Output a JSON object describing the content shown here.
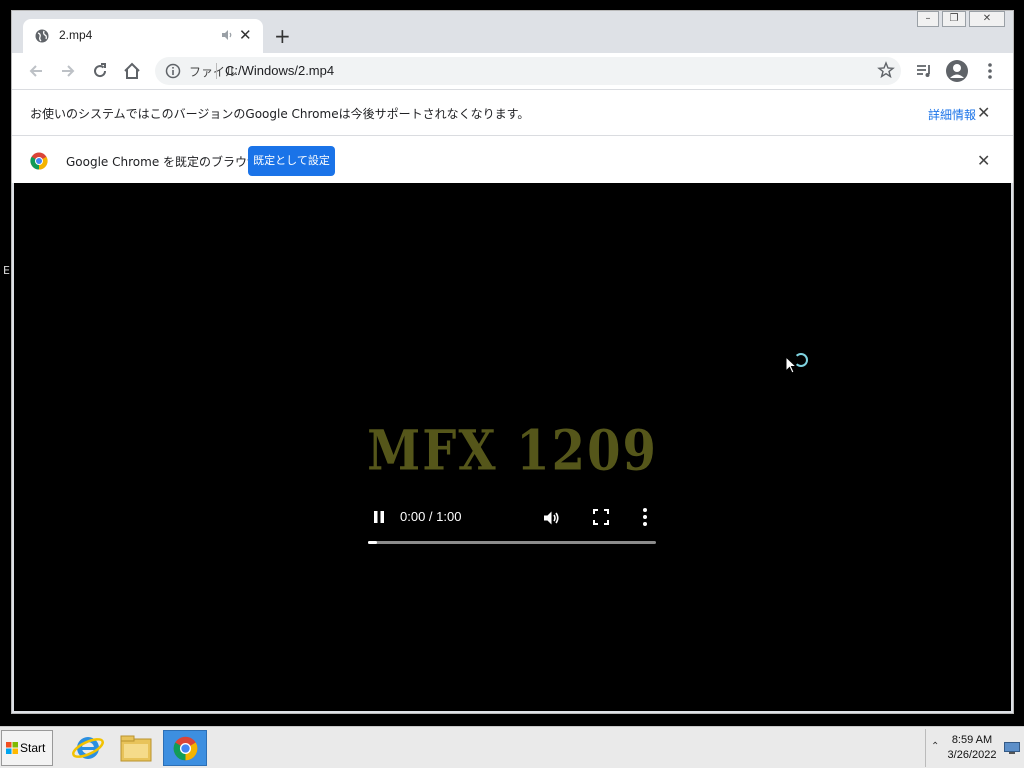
{
  "tab": {
    "title": "2.mp4"
  },
  "omnibox": {
    "file_label": "ファイル",
    "url": "C:/Windows/2.mp4"
  },
  "infobar1": {
    "message": "お使いのシステムではこのバージョンのGoogle Chromeは今後サポートされなくなります。",
    "link": "詳細情報"
  },
  "infobar2": {
    "message": "Google Chrome を既定のブラウザに",
    "button": "既定として設定"
  },
  "video": {
    "title_text": "MFX 1209",
    "time": "0:00 / 1:00",
    "progress": 0.03
  },
  "taskbar": {
    "start": "Start",
    "time": "8:59 AM",
    "date": "3/26/2022"
  },
  "colors": {
    "accent": "#1a73e8",
    "video_title": "#55561a"
  },
  "desktop": {
    "side_letter": "E"
  }
}
